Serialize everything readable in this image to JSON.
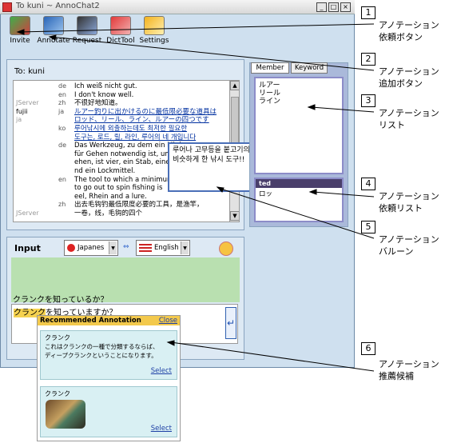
{
  "window": {
    "title": "To kuni ~ AnnoChat2",
    "buttons": [
      "_",
      "□",
      "×"
    ]
  },
  "toolbar": [
    {
      "label": "Invite",
      "icon": "invite-icon"
    },
    {
      "label": "Annotate",
      "icon": "annotate-icon"
    },
    {
      "label": "Request",
      "icon": "request-icon"
    },
    {
      "label": "DictTool",
      "icon": "dicttool-icon"
    },
    {
      "label": "Settings",
      "icon": "settings-icon"
    }
  ],
  "chat": {
    "to": "To: kuni",
    "messages": [
      {
        "nick": "",
        "lang": "de",
        "text": "Ich weiß nicht gut."
      },
      {
        "nick": "",
        "lang": "en",
        "text": "I don't know well."
      },
      {
        "nick": "JServer",
        "lang": "zh",
        "text": "不很好地知道。"
      },
      {
        "nick": "fujii",
        "lang": "ja",
        "text": "ルアー釣りに出かけるのに最低限必要な道具は"
      },
      {
        "nick": "ja",
        "lang": "",
        "text": "ロッド、リール、ライン、ルアーの四つです"
      },
      {
        "nick": "",
        "lang": "ko",
        "text": "루어낚시에 외출하는데도 최저한 필요한"
      },
      {
        "nick": "",
        "lang": "",
        "text": "도구는, 로드, 릴, 라인, 루어의 네 개입니다"
      },
      {
        "nick": "",
        "lang": "de",
        "text": "Das Werkzeug, zu dem ein Minimum"
      },
      {
        "nick": "",
        "lang": "",
        "text": "für Gehen notwendig ist, um"
      },
      {
        "nick": "",
        "lang": "",
        "text": "ehen, ist vier, ein Stab, eine"
      },
      {
        "nick": "",
        "lang": "",
        "text": "nd ein Lockmittel."
      },
      {
        "nick": "",
        "lang": "en",
        "text": "The tool to which a minimum"
      },
      {
        "nick": "",
        "lang": "",
        "text": "to go out to spin fishing is"
      },
      {
        "nick": "",
        "lang": "",
        "text": "eel, Rhein and a lure."
      },
      {
        "nick": "",
        "lang": "zh",
        "text": "出去毛钩钓最低限度必要的工具，是渔竿，"
      },
      {
        "nick": "JServer",
        "lang": "",
        "text": "一卷，线，毛钩的四个"
      }
    ]
  },
  "side_tabs": [
    "Member",
    "Keyword"
  ],
  "annotation_list": [
    "ルアー",
    "リール",
    "ライン"
  ],
  "request_list": {
    "header": "ted",
    "item": "ロッ"
  },
  "balloon_text": "루어나 고무등을 붙고기의 먹이에 비슷하게 한 낚시 도구!!",
  "input": {
    "label": "Input",
    "src_lang": "Japanes",
    "dst_lang": "English",
    "arrow": "⇔",
    "preview": "クランクを知っているか？",
    "text_highlight": "クランク",
    "text_rest": "を知っていますか？",
    "send": "↵"
  },
  "recommend": {
    "title": "Recommended Annotation",
    "close": "Close",
    "cards": [
      {
        "word": "クランク",
        "desc1": "これはクランクの一種で分類するならば、",
        "desc2": "ディープクランクということになります。",
        "select": "Select"
      },
      {
        "word": "クランク",
        "desc1": "",
        "desc2": "",
        "select": "Select"
      }
    ]
  },
  "callouts": [
    {
      "num": "1",
      "l1": "アノテーション",
      "l2": "依頼ボタン"
    },
    {
      "num": "2",
      "l1": "アノテーション",
      "l2": "追加ボタン"
    },
    {
      "num": "3",
      "l1": "アノテーション",
      "l2": "リスト"
    },
    {
      "num": "4",
      "l1": "アノテーション",
      "l2": "依頼リスト"
    },
    {
      "num": "5",
      "l1": "アノテーション",
      "l2": "バルーン"
    },
    {
      "num": "6",
      "l1": "アノテーション",
      "l2": "推薦候補"
    }
  ]
}
